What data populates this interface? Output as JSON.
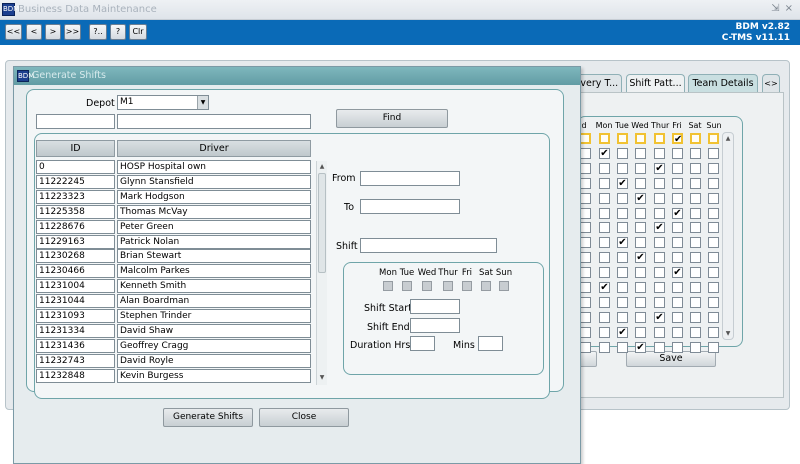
{
  "main_window": {
    "title": "Business Data Maintenance",
    "controls": "⇲ ×",
    "app_icon": "BDM",
    "toolbar": {
      "buttons": [
        "<<",
        "<",
        ">",
        ">>",
        "?..",
        "?",
        "Clr"
      ],
      "bdm_version": "BDM v2.82",
      "ctms_version": "C-TMS v11.11"
    },
    "tabs": [
      "ivery T...",
      "Shift Patt...",
      "Team Details",
      "<>"
    ],
    "day_headers": [
      "d",
      "Mon",
      "Tue",
      "Wed",
      "Thur",
      "Fri",
      "Sat",
      "Sun"
    ],
    "checked_grid": [
      [
        false,
        false,
        false,
        false,
        true,
        false,
        false
      ],
      [
        true,
        false,
        false,
        false,
        false,
        false,
        false
      ],
      [
        false,
        false,
        false,
        true,
        false,
        false,
        false
      ],
      [
        false,
        true,
        false,
        false,
        false,
        false,
        false
      ],
      [
        false,
        false,
        true,
        false,
        false,
        false,
        false
      ],
      [
        false,
        false,
        false,
        false,
        true,
        false,
        false
      ],
      [
        false,
        false,
        false,
        true,
        false,
        false,
        false
      ],
      [
        false,
        true,
        false,
        false,
        false,
        false,
        false
      ],
      [
        false,
        false,
        true,
        false,
        false,
        false,
        false
      ],
      [
        false,
        false,
        false,
        false,
        true,
        false,
        false
      ],
      [
        true,
        false,
        false,
        false,
        false,
        false,
        false
      ],
      [
        false,
        false,
        false,
        false,
        false,
        false,
        false
      ],
      [
        false,
        false,
        false,
        true,
        false,
        false,
        false
      ],
      [
        false,
        true,
        false,
        false,
        false,
        false,
        false
      ],
      [
        false,
        false,
        true,
        false,
        false,
        false,
        false
      ]
    ],
    "save_label": "Save"
  },
  "dialog": {
    "title": "Generate Shifts",
    "icon": "BDM",
    "depot_label": "Depot",
    "depot_value": "M1",
    "find_label": "Find",
    "columns": {
      "id": "ID",
      "driver": "Driver"
    },
    "rows": [
      {
        "id": "0",
        "driver": "HOSP Hospital own"
      },
      {
        "id": "11222245",
        "driver": "Glynn Stansfield"
      },
      {
        "id": "11223323",
        "driver": "Mark Hodgson"
      },
      {
        "id": "11225358",
        "driver": "Thomas McVay"
      },
      {
        "id": "11228676",
        "driver": "Peter Green"
      },
      {
        "id": "11229163",
        "driver": "Patrick Nolan"
      },
      {
        "id": "11230268",
        "driver": "Brian Stewart"
      },
      {
        "id": "11230466",
        "driver": "Malcolm Parkes"
      },
      {
        "id": "11231004",
        "driver": "Kenneth Smith"
      },
      {
        "id": "11231044",
        "driver": "Alan Boardman"
      },
      {
        "id": "11231093",
        "driver": "Stephen Trinder"
      },
      {
        "id": "11231334",
        "driver": "David Shaw"
      },
      {
        "id": "11231436",
        "driver": "Geoffrey Cragg"
      },
      {
        "id": "11232743",
        "driver": "David Royle"
      },
      {
        "id": "11232848",
        "driver": "Kevin Burgess"
      }
    ],
    "from_label": "From",
    "to_label": "To",
    "shift_label": "Shift",
    "days": [
      "Mon",
      "Tue",
      "Wed",
      "Thur",
      "Fri",
      "Sat",
      "Sun"
    ],
    "shift_start_label": "Shift Start",
    "shift_end_label": "Shift End",
    "duration_label": "Duration Hrs",
    "mins_label": "Mins",
    "generate_label": "Generate Shifts",
    "close_label": "Close"
  },
  "colors": {
    "toolbar": "#0a6ab7",
    "dialog_title": "#6aa5ac",
    "frame_border": "#6fa5a9",
    "highlight_checkbox": "#f1c232"
  }
}
